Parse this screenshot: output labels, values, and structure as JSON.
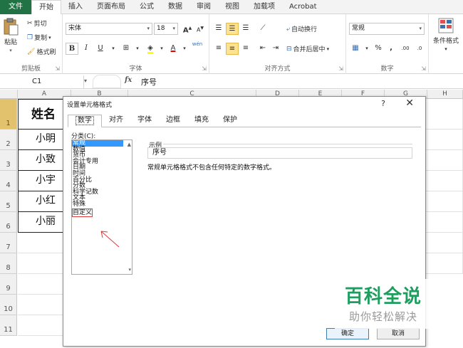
{
  "ribbon_tabs": [
    "文件",
    "开始",
    "插入",
    "页面布局",
    "公式",
    "数据",
    "审阅",
    "视图",
    "加载项",
    "Acrobat"
  ],
  "clipboard": {
    "paste": "粘贴",
    "cut": "剪切",
    "copy": "复制",
    "format_painter": "格式刷",
    "group_label": "剪贴板"
  },
  "font": {
    "name": "宋体",
    "size": "18",
    "grow": "A",
    "shrink": "A",
    "bold": "B",
    "italic": "I",
    "underline": "U",
    "font_color": "A",
    "phonetic": "wén",
    "group_label": "字体"
  },
  "alignment": {
    "wrap_text": "自动换行",
    "merge_center": "合并后居中",
    "group_label": "对齐方式"
  },
  "number": {
    "format": "常规",
    "percent": "%",
    "comma": ",",
    "inc_decimal": ".00",
    "dec_decimal": ".0",
    "group_label": "数字"
  },
  "styles": {
    "conditional_formatting": "条件格式"
  },
  "formula_bar": {
    "name_box": "C1",
    "fx": "fx",
    "value": "序号"
  },
  "columns": [
    "A",
    "B",
    "C",
    "D",
    "E",
    "F",
    "G",
    "H"
  ],
  "rows": [
    "1",
    "2",
    "3",
    "4",
    "5",
    "6",
    "7",
    "8",
    "9",
    "10",
    "11"
  ],
  "names": [
    "姓名",
    "小明",
    "小致",
    "小宇",
    "小红",
    "小丽"
  ],
  "dialog": {
    "title": "设置单元格格式",
    "help": "?",
    "close": "✕",
    "tabs": [
      "数字",
      "对齐",
      "字体",
      "边框",
      "填充",
      "保护"
    ],
    "category_label": "分类(C):",
    "categories": [
      "常规",
      "数值",
      "货币",
      "会计专用",
      "日期",
      "时间",
      "百分比",
      "分数",
      "科学记数",
      "文本",
      "特殊",
      "自定义"
    ],
    "sample_label": "示例",
    "sample_value": "序号",
    "description": "常规单元格格式不包含任何特定的数字格式。",
    "ok": "确定",
    "cancel": "取消"
  },
  "watermark": {
    "main": "百科全说",
    "sub": "助你轻松解决"
  },
  "colors": {
    "file_tab": "#217346",
    "selection": "#3399ff",
    "annotation": "#e03a3a",
    "watermark": "#1e9e5e"
  }
}
